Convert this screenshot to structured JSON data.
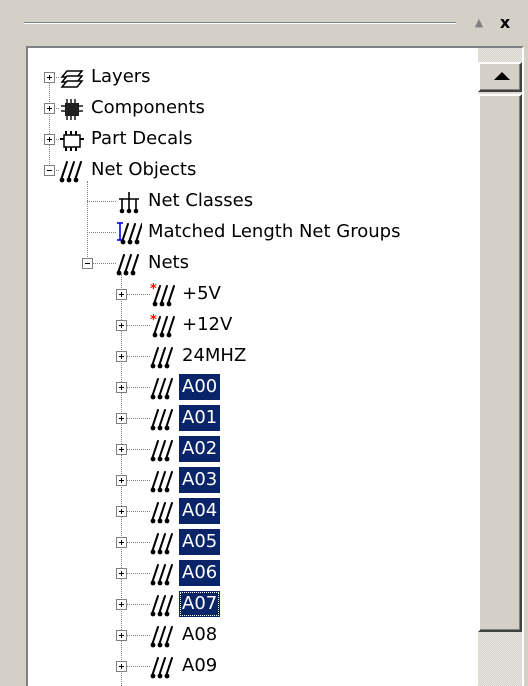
{
  "toolbar": {
    "maximize_glyph": "▲",
    "close_glyph": "x"
  },
  "tree": {
    "items": [
      {
        "label": "Layers",
        "icon": "layers-icon",
        "depth": 0,
        "expander": "plus"
      },
      {
        "label": "Components",
        "icon": "component-chip-icon",
        "depth": 0,
        "expander": "plus"
      },
      {
        "label": "Part Decals",
        "icon": "part-decal-icon",
        "depth": 0,
        "expander": "plus"
      },
      {
        "label": "Net Objects",
        "icon": "net-icon",
        "depth": 0,
        "expander": "minus"
      },
      {
        "label": "Net Classes",
        "icon": "net-class-icon",
        "depth": 1,
        "expander": "none"
      },
      {
        "label": "Matched Length Net Groups",
        "icon": "matched-length-icon",
        "depth": 1,
        "expander": "none"
      },
      {
        "label": "Nets",
        "icon": "net-icon",
        "depth": 1,
        "expander": "minus"
      },
      {
        "label": "+5V",
        "icon": "power-net-icon",
        "depth": 2,
        "expander": "plus"
      },
      {
        "label": "+12V",
        "icon": "power-net-icon",
        "depth": 2,
        "expander": "plus"
      },
      {
        "label": "24MHZ",
        "icon": "net-icon",
        "depth": 2,
        "expander": "plus"
      },
      {
        "label": "A00",
        "icon": "net-icon",
        "depth": 2,
        "expander": "plus",
        "selected": true
      },
      {
        "label": "A01",
        "icon": "net-icon",
        "depth": 2,
        "expander": "plus",
        "selected": true
      },
      {
        "label": "A02",
        "icon": "net-icon",
        "depth": 2,
        "expander": "plus",
        "selected": true
      },
      {
        "label": "A03",
        "icon": "net-icon",
        "depth": 2,
        "expander": "plus",
        "selected": true
      },
      {
        "label": "A04",
        "icon": "net-icon",
        "depth": 2,
        "expander": "plus",
        "selected": true
      },
      {
        "label": "A05",
        "icon": "net-icon",
        "depth": 2,
        "expander": "plus",
        "selected": true
      },
      {
        "label": "A06",
        "icon": "net-icon",
        "depth": 2,
        "expander": "plus",
        "selected": true
      },
      {
        "label": "A07",
        "icon": "net-icon",
        "depth": 2,
        "expander": "plus",
        "selected": true,
        "focused": true
      },
      {
        "label": "A08",
        "icon": "net-icon",
        "depth": 2,
        "expander": "plus"
      },
      {
        "label": "A09",
        "icon": "net-icon",
        "depth": 2,
        "expander": "plus"
      }
    ]
  },
  "colors": {
    "selection_bg": "#0a246a",
    "selection_text": "#ffffff",
    "window_bg": "#d4d0c8",
    "power_marker": "#ff0000",
    "matched_length_marker": "#0000ff"
  }
}
